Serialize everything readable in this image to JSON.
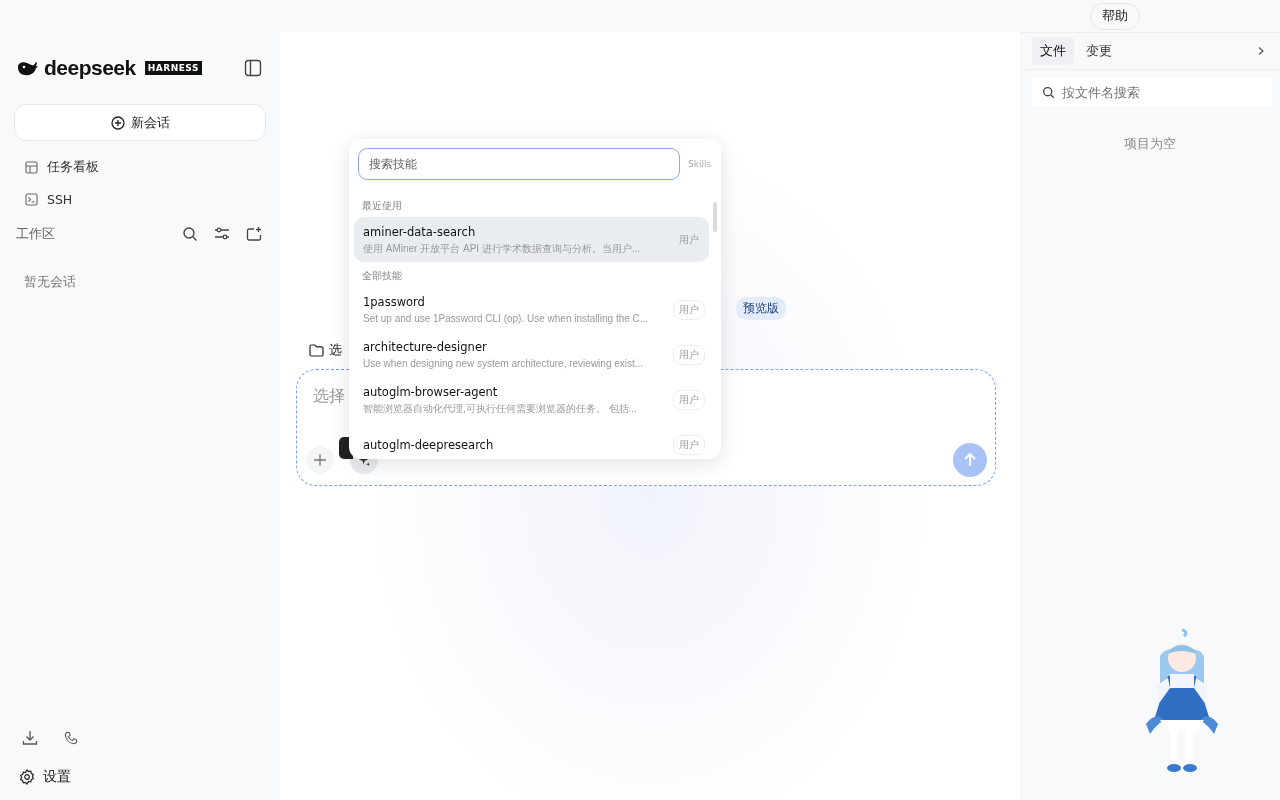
{
  "top_bar": {
    "help_button": "帮助"
  },
  "sidebar": {
    "brand": {
      "name": "deepseek",
      "tag": "HARNESS"
    },
    "new_chat": "新会话",
    "nav": [
      {
        "label": "任务看板",
        "kind": "board"
      },
      {
        "label": "SSH",
        "kind": "terminal"
      }
    ],
    "workspace": {
      "label": "工作区",
      "empty_text": "暂无会话"
    },
    "settings": "设置"
  },
  "main": {
    "badge": "预览版",
    "folder_label": "选",
    "composer": {
      "placeholder": "选择"
    },
    "skills_popup": {
      "search": {
        "placeholder": "搜索技能"
      },
      "hint": "Skills",
      "sections": [
        {
          "title": "最近使用",
          "items": [
            {
              "name": "aminer-data-search",
              "description": "使用 AMiner 开放平台 API 进行学术数据查询与分析。当用户...",
              "tag": "用户",
              "selected": true
            }
          ]
        },
        {
          "title": "全部技能",
          "items": [
            {
              "name": "1password",
              "description": "Set up and use 1Password CLI (op). Use when installing the C...",
              "tag": "用户",
              "selected": false
            },
            {
              "name": "architecture-designer",
              "description": "Use when designing new system architecture, reviewing exist...",
              "tag": "用户",
              "selected": false
            },
            {
              "name": "autoglm-browser-agent",
              "description": "智能浏览器自动化代理,可执行任何需要浏览器的任务。 包括...",
              "tag": "用户",
              "selected": false
            },
            {
              "name": "autoglm-deepresearch",
              "tag": "用户",
              "selected": false
            }
          ]
        }
      ]
    }
  },
  "right_panel": {
    "tabs": [
      {
        "label": "文件",
        "selected": true
      },
      {
        "label": "变更",
        "selected": false
      }
    ],
    "search": {
      "placeholder": "按文件名搜索"
    },
    "empty_text": "项目为空"
  }
}
